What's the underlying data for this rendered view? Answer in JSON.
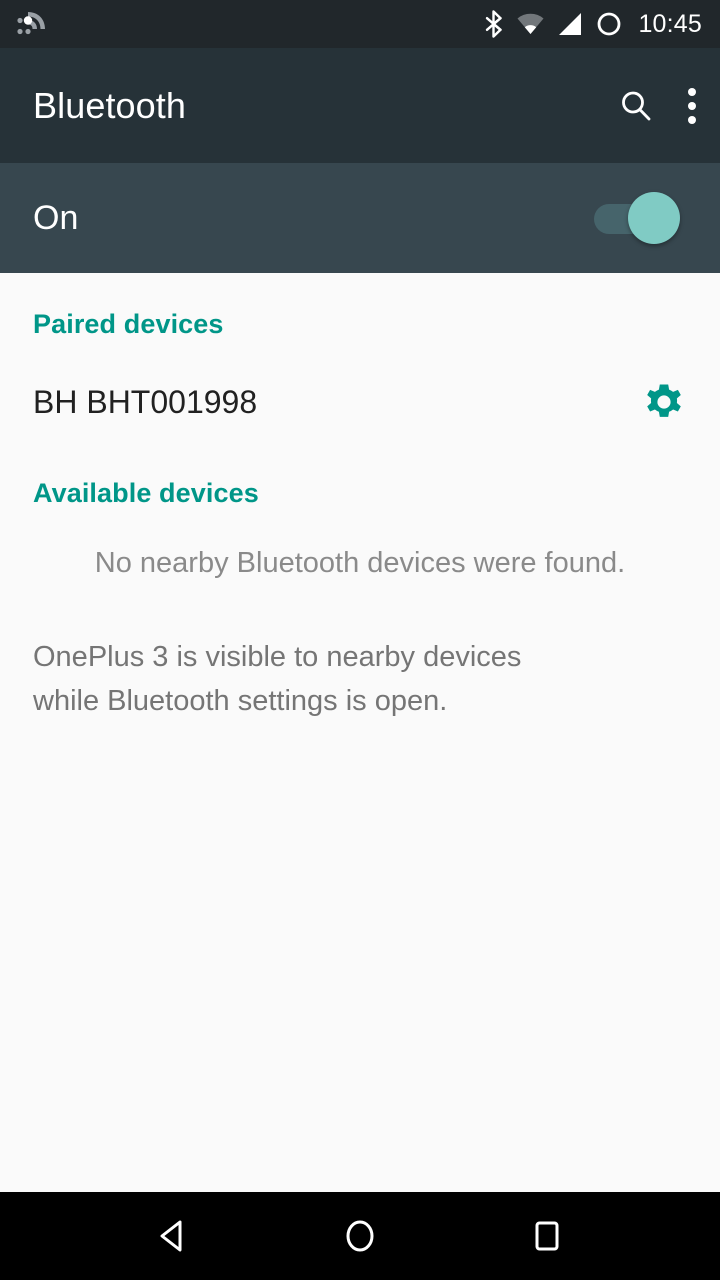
{
  "status_bar": {
    "time": "10:45",
    "icons": [
      {
        "name": "notification-rss-icon",
        "label": "notification"
      },
      {
        "name": "bluetooth-icon",
        "label": "bluetooth"
      },
      {
        "name": "wifi-icon",
        "label": "wifi"
      },
      {
        "name": "cellular-signal-icon",
        "label": "cellular signal"
      },
      {
        "name": "battery-icon",
        "label": "battery"
      }
    ],
    "background_color": "#21272B"
  },
  "app_bar": {
    "title": "Bluetooth",
    "search_label": "Search",
    "overflow_label": "More options",
    "background_color": "#263238"
  },
  "toggle_row": {
    "state_label": "On",
    "switch_on": true,
    "background_color": "#37474F",
    "thumb_color": "#80CBC4",
    "track_color": "#46646B"
  },
  "accent_color": "#009688",
  "content": {
    "background_color": "#FAFAFA",
    "paired_section": {
      "header": "Paired devices",
      "devices": [
        {
          "name": "BH BHT001998",
          "settings_label": "Device settings"
        }
      ]
    },
    "available_section": {
      "header": "Available devices",
      "empty_message": "No nearby Bluetooth devices were found."
    },
    "footer_note": "OnePlus 3 is visible to nearby devices while Bluetooth settings is open."
  },
  "nav_bar": {
    "background_color": "#000000",
    "buttons": [
      {
        "name": "back-button",
        "label": "Back"
      },
      {
        "name": "home-button",
        "label": "Home"
      },
      {
        "name": "recents-button",
        "label": "Recent apps"
      }
    ]
  }
}
